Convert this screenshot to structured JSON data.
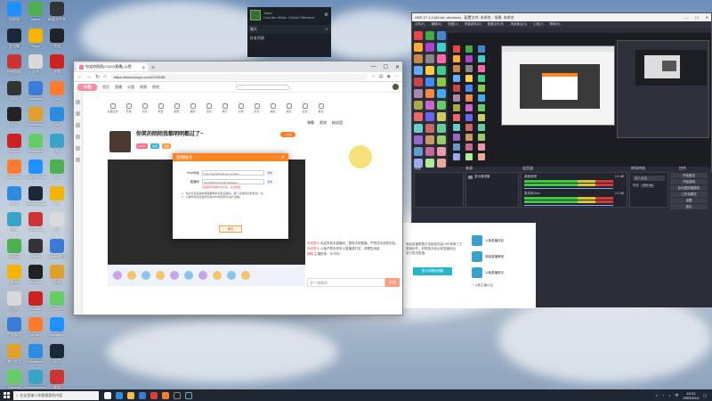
{
  "desktop": {
    "icons_col1": [
      "回收站",
      "此电脑",
      "控制面板",
      "网络",
      "QQ",
      "Steam",
      "WeGame",
      "OBS",
      "Epic",
      "网易云",
      "雷神",
      "迅雷",
      "百度网盘",
      "腾讯会议",
      "Chrome"
    ],
    "icons_col2": [
      "Adobe",
      "Edge",
      "文件",
      "Illustrator",
      "Photoshop",
      "Premiere",
      "After Effects",
      "Media Encoder",
      "Lightroom",
      "Bridge",
      "Audition",
      "Animate",
      "InCopy",
      "Character",
      "Dreamweaver"
    ],
    "icons_col3": [
      "新建文件夹",
      "文档",
      "视频",
      "Dw",
      "Ps",
      "Ai",
      "Lrc",
      "Id",
      "Pl",
      "Steam游戏",
      "游戏",
      "Opera GX",
      "Wallpaper",
      "网页",
      "截图"
    ]
  },
  "steam_popup": {
    "user": "Joker",
    "status": "Counter-Strike: Global Offensive",
    "chat_label": "聊天",
    "footer": "好友列表"
  },
  "browser": {
    "tab_title": "你笑的陌陌(CSGO直播)-斗鱼",
    "url": "https://www.douyu.com/2133188",
    "site": {
      "logo": "斗鱼",
      "nav": [
        "首页",
        "直播",
        "分类",
        "视频",
        "鱼吧"
      ],
      "func_items": [
        "主播任务",
        "开播",
        "分区",
        "粉丝",
        "贡献",
        "福利",
        "活动",
        "排行",
        "礼物",
        "背包",
        "抽奖",
        "消息",
        "设置",
        "更多"
      ],
      "stream_title": "你笑的陌陌我都明明都过了~",
      "follow_label": "+ 关注",
      "tags": [
        "CSGO",
        "在线",
        "主播"
      ],
      "chat_tabs": [
        "弹幕",
        "贵宾",
        "粉丝团"
      ],
      "chat_lines": [
        {
          "user": "系统提示",
          "text": "欢迎来到本直播间，倡导文明直播，严禁违法违规内容。"
        },
        {
          "user": "系统提示",
          "text": "斗鱼严禁未成年人直播或打赏，请理性消费。"
        },
        {
          "user": "弹幕",
          "text": "主播好帅，冲冲冲！"
        }
      ],
      "chat_placeholder": "发个弹幕呗",
      "send_label": "发送"
    },
    "dialog": {
      "title": "直播推流",
      "rtmp_label": "rtmp地址",
      "rtmp_value": "rtmp://sendtc3.douyu.com/live",
      "copy1": "复制",
      "key_label": "直播码",
      "key_value": "2133188rXmGngtbTwGaGw...",
      "copy2": "复制",
      "key_note": "直播码有效期为5分钟，点击刷新",
      "tips": [
        "1、每次开启直播前都需要重新获取直播码，每个直播码仅能使用一次。",
        "2、只推荐使用直播伴侣或OBS推流软件进行直播。"
      ],
      "ok_label": "确定"
    }
  },
  "obs": {
    "title": "OBS 27.1.3 (64-bit, windows) - 配置文件: 未命名 - 场景: 未命名",
    "menu": [
      "文件(F)",
      "编辑(E)",
      "视图(V)",
      "停靠部件(D)",
      "配置文件(P)",
      "场景集合(S)",
      "工具(T)",
      "帮助(H)"
    ],
    "docks": {
      "scenes": "场景",
      "sources": "来源",
      "mixer": "混音器",
      "transitions": "转场特效",
      "controls": "控件"
    },
    "mixer_tracks": [
      {
        "name": "桌面音频",
        "level": "0.0 dB"
      },
      {
        "name": "麦克风/Aux",
        "level": "0.0 dB"
      }
    ],
    "transition": {
      "name": "淡入淡出",
      "duration_label": "时长",
      "duration": "300 ms"
    },
    "controls": [
      "开始推流",
      "开始录制",
      "启动虚拟摄像机",
      "工作室模式",
      "设置",
      "退出"
    ]
  },
  "webpage": {
    "text_lines": [
      "电脑直播需要在电脑端安装OBS等第三方",
      "直播软件，获取推流地址和直播码后",
      "进行推流直播。"
    ],
    "button": "官方问题反馈群",
    "items": [
      "斗鱼直播伴侣",
      "电脑直播教程",
      "斗鱼直播助手"
    ],
    "footer": "+ 斗鱼主播认证"
  },
  "taskbar": {
    "search_placeholder": "在这里输入你要搜索的内容",
    "time": "19:21",
    "date": "2022/4/14"
  }
}
